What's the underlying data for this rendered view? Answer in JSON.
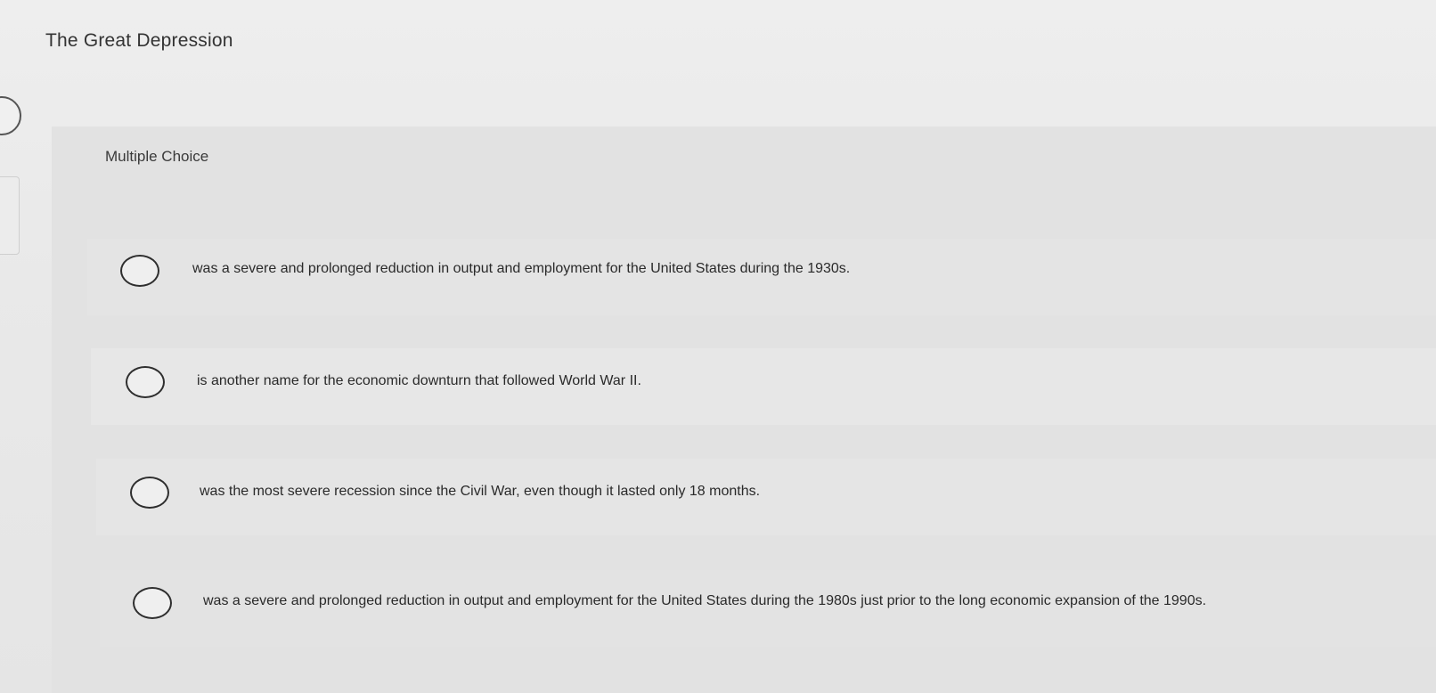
{
  "header": {
    "title": "The Great Depression"
  },
  "question": {
    "type_label": "Multiple Choice",
    "choices": [
      {
        "label": "was a severe and prolonged reduction in output and employment for the United States during the 1930s."
      },
      {
        "label": "is another name for the economic downturn that followed World War II."
      },
      {
        "label": "was the most severe recession since the Civil War, even though it lasted only 18 months."
      },
      {
        "label": "was a severe and prolonged reduction in output and employment for the United States during the 1980s just prior to the long economic expansion of the 1990s."
      }
    ]
  }
}
